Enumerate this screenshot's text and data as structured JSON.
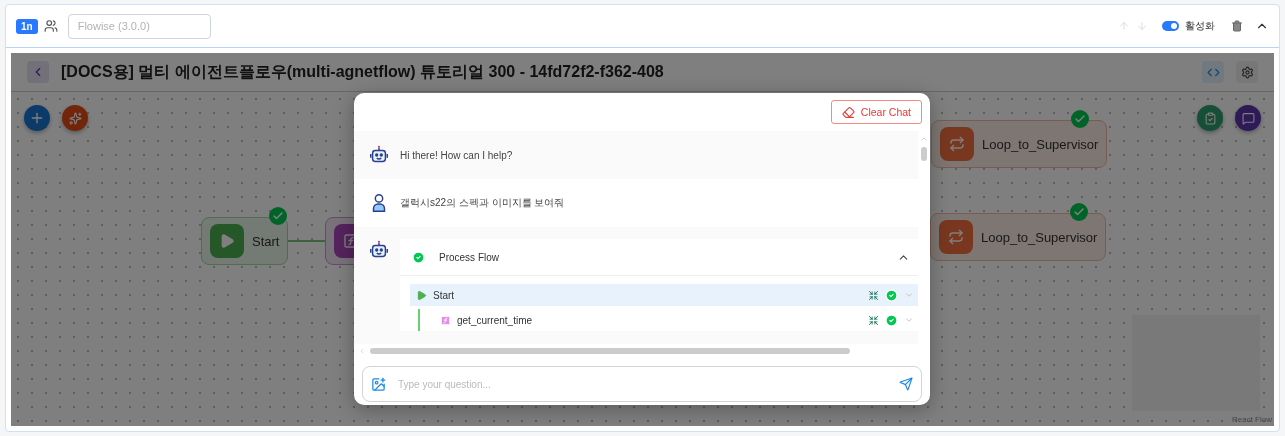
{
  "header": {
    "badge": "1n",
    "search": {
      "placeholder": "Flowise (3.0.0)"
    },
    "toggle": {
      "label": "활성화",
      "on": true
    }
  },
  "flow": {
    "title": "[DOCS용] 멀티 에이전트플로우(multi-agnetflow) 튜토리얼 300 - 14fd72f2-f362-408",
    "nodes": [
      {
        "kind": "start",
        "label": "Start",
        "done": true
      },
      {
        "kind": "tool"
      },
      {
        "kind": "loop",
        "label": "Loop_to_Supervisor",
        "done": true
      },
      {
        "kind": "loop",
        "label": "Loop_to_Supervisor",
        "done": true
      }
    ],
    "attribution": "React Flow"
  },
  "chat": {
    "clear_button": "Clear Chat",
    "messages": [
      {
        "kind": "bot",
        "text": "Hi there! How can I help?"
      },
      {
        "kind": "user",
        "text": "갤럭시s22의 스펙과 이미지를 보여줘"
      },
      {
        "kind": "flow",
        "title": "Process Flow",
        "done": true,
        "expanded": true,
        "steps": [
          {
            "kind": "start",
            "label": "Start",
            "selected": true,
            "done": true
          },
          {
            "kind": "tool",
            "label": "get_current_time",
            "selected": false,
            "done": true
          }
        ]
      }
    ],
    "input": {
      "placeholder": "Type your question..."
    }
  }
}
